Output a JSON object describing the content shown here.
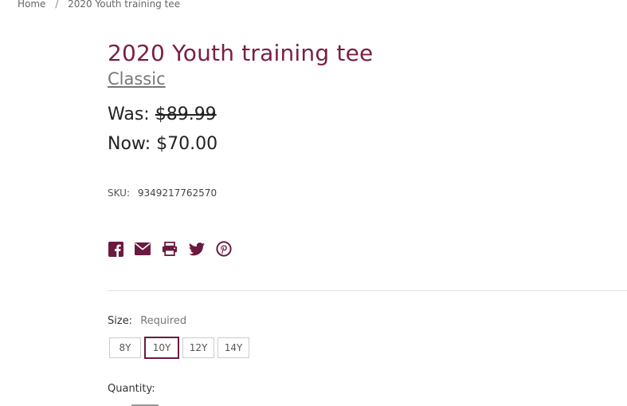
{
  "breadcrumb": {
    "home": "Home",
    "separator": "/",
    "current": "2020 Youth training tee"
  },
  "product": {
    "title": "2020 Youth training tee",
    "brand": "Classic",
    "price_was_label": "Was:",
    "price_was_value": "$89.99",
    "price_now_label": "Now:",
    "price_now_value": "$70.00",
    "sku_label": "SKU:",
    "sku_value": "9349217762570"
  },
  "share": {
    "icons": [
      "facebook-icon",
      "email-icon",
      "print-icon",
      "twitter-icon",
      "pinterest-icon"
    ],
    "icon_color": "#6a1a3f"
  },
  "options": {
    "size_label": "Size:",
    "size_required": "Required",
    "sizes": [
      "8Y",
      "10Y",
      "12Y",
      "14Y"
    ],
    "selected_size": "10Y",
    "quantity_label": "Quantity:"
  },
  "colors": {
    "title": "#7a1f45",
    "accent": "#6a1a3f"
  }
}
